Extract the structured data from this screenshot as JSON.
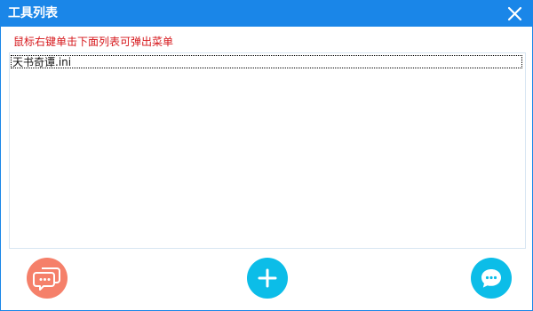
{
  "window": {
    "title": "工具列表",
    "close_icon": "close-icon"
  },
  "hint": {
    "text": "鼠标右键单击下面列表可弹出菜单"
  },
  "list": {
    "items": [
      {
        "label": "天书奇谭.ini",
        "selected": true
      }
    ]
  },
  "actions": {
    "feedback_icon": "feedback-icon",
    "add_icon": "plus-icon",
    "chat_icon": "chat-icon"
  },
  "colors": {
    "titlebar": "#1a86e8",
    "hint_text": "#d6181c",
    "feedback_button": "#f5806a",
    "primary_button": "#0cbde8"
  }
}
